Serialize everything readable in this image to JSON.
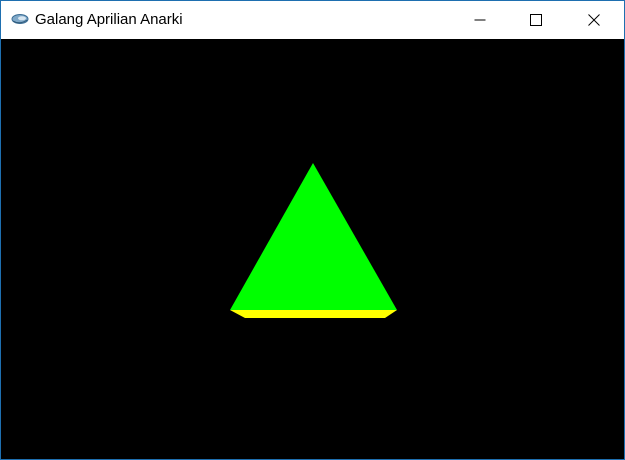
{
  "window": {
    "title": "Galang Aprilian Anarki",
    "icon": "app-logo-icon",
    "controls": [
      "minimize-icon",
      "maximize-icon",
      "close-icon"
    ]
  },
  "scene": {
    "background": "#000000",
    "shape": "pyramid",
    "face_color": "#00ff00",
    "base_color": "#ffff00"
  }
}
